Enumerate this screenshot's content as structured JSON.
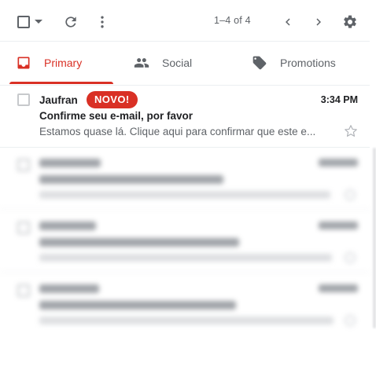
{
  "toolbar": {
    "select_icon": "checkbox-icon",
    "select_menu_icon": "caret-down-icon",
    "refresh_icon": "refresh-icon",
    "more_icon": "more-vert-icon",
    "pagination": "1–4 of 4",
    "prev_icon": "chevron-left-icon",
    "next_icon": "chevron-right-icon",
    "settings_icon": "gear-icon"
  },
  "tabs": [
    {
      "label": "Primary",
      "icon": "inbox-icon",
      "active": true
    },
    {
      "label": "Social",
      "icon": "people-icon",
      "active": false
    },
    {
      "label": "Promotions",
      "icon": "tag-icon",
      "active": false
    }
  ],
  "email": {
    "sender": "Jaufran",
    "badge": "NOVO!",
    "time": "3:34 PM",
    "subject": "Confirme seu e-mail, por favor",
    "snippet": "Estamos quase lá. Clique aqui para confirmar que este e...",
    "star_icon": "star-outline-icon"
  },
  "colors": {
    "accent": "#d93025",
    "icon_gray": "#5f6368",
    "text_dark": "#202124",
    "divider": "#eceff1"
  }
}
